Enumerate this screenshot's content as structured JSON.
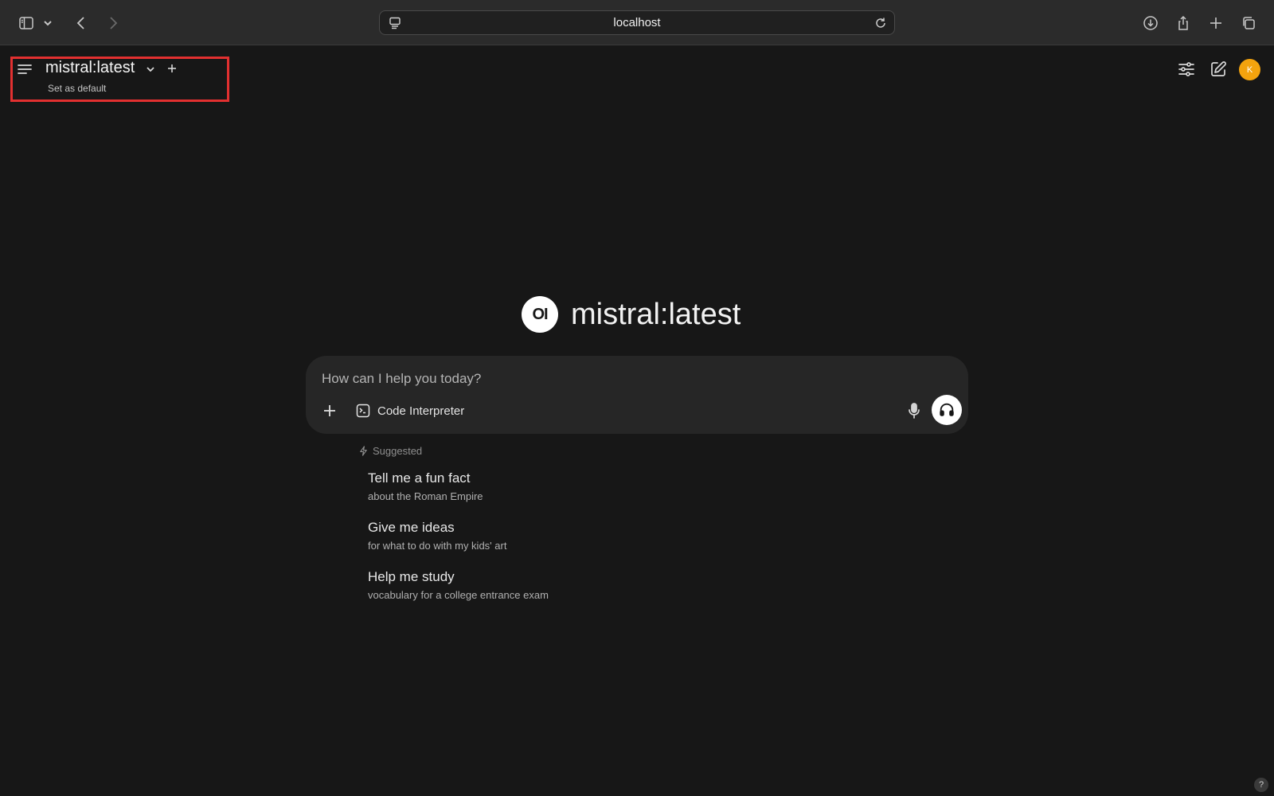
{
  "browser": {
    "url": "localhost"
  },
  "header": {
    "model_name": "mistral:latest",
    "set_default_label": "Set as default",
    "avatar_initial": "K"
  },
  "hero": {
    "logo_text": "OI",
    "title": "mistral:latest"
  },
  "composer": {
    "placeholder": "How can I help you today?",
    "value": "",
    "code_interpreter_label": "Code Interpreter"
  },
  "suggestions": {
    "label": "Suggested",
    "items": [
      {
        "title": "Tell me a fun fact",
        "subtitle": "about the Roman Empire"
      },
      {
        "title": "Give me ideas",
        "subtitle": "for what to do with my kids' art"
      },
      {
        "title": "Help me study",
        "subtitle": "vocabulary for a college entrance exam"
      }
    ]
  },
  "footer": {
    "help_label": "?"
  },
  "colors": {
    "background": "#171717",
    "browser_bar": "#2b2b2b",
    "composer": "#262626",
    "avatar": "#f3a30e",
    "highlight": "#e23030"
  }
}
